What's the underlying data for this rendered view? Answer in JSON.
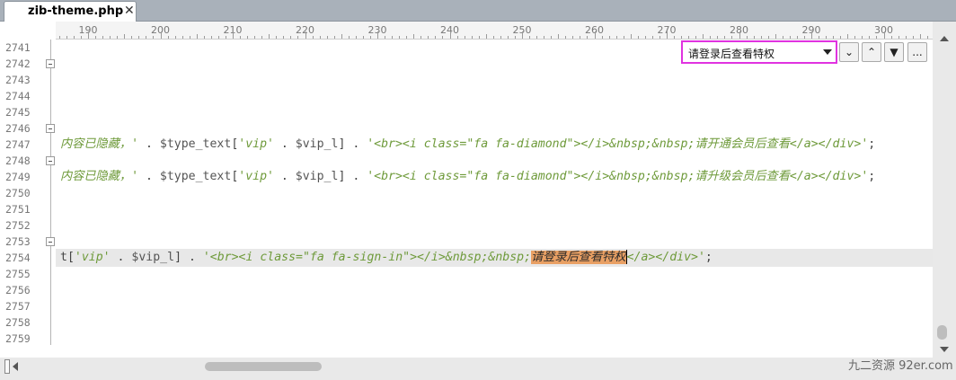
{
  "tab": {
    "filename": "zib-theme.php",
    "close_symbol": "✕"
  },
  "ruler": {
    "ticks": [
      "190",
      "200",
      "210",
      "220",
      "230",
      "240",
      "250",
      "260",
      "270",
      "280",
      "290",
      "300"
    ]
  },
  "gutter": {
    "line_numbers": [
      "2741",
      "2742",
      "2743",
      "2744",
      "2745",
      "2746",
      "2747",
      "2748",
      "2749",
      "2750",
      "2751",
      "2752",
      "2753",
      "2754",
      "2755",
      "2756",
      "2757",
      "2758",
      "2759"
    ]
  },
  "code": {
    "line_2747": {
      "s1": "内容已隐藏，'",
      "p1": " . ",
      "v1": "$type_text",
      "p2": "[",
      "s2": "'vip'",
      "p3": " . ",
      "v2": "$vip_l",
      "p4": "] . ",
      "s3": "'<br><i class=\"fa fa-diamond\"></i>&nbsp;&nbsp;请开通会员后查看</a></div>'",
      "p5": ";"
    },
    "line_2749": {
      "s1": "内容已隐藏，'",
      "p1": " . ",
      "v1": "$type_text",
      "p2": "[",
      "s2": "'vip'",
      "p3": " . ",
      "v2": "$vip_l",
      "p4": "] . ",
      "s3": "'<br><i class=\"fa fa-diamond\"></i>&nbsp;&nbsp;请升级会员后查看</a></div>'",
      "p5": ";"
    },
    "line_2754": {
      "p0": "t[",
      "s2": "'vip'",
      "p3": " . ",
      "v2": "$vip_l",
      "p4": "] . ",
      "s3": "'<br><i class=\"fa fa-sign-in\"></i>&nbsp;&nbsp;",
      "hl": "请登录后查看特权",
      "s4": "</a></div>'",
      "p5": ";"
    }
  },
  "find": {
    "value": "请登录后查看特权",
    "buttons": {
      "next": "⌄",
      "prev": "⌃",
      "filter": "▼",
      "more": "..."
    }
  },
  "watermark": "九二资源 92er.com",
  "colors": {
    "string": "#6e9a3a",
    "highlight": "#e9a064",
    "find_border": "#e033e0"
  }
}
